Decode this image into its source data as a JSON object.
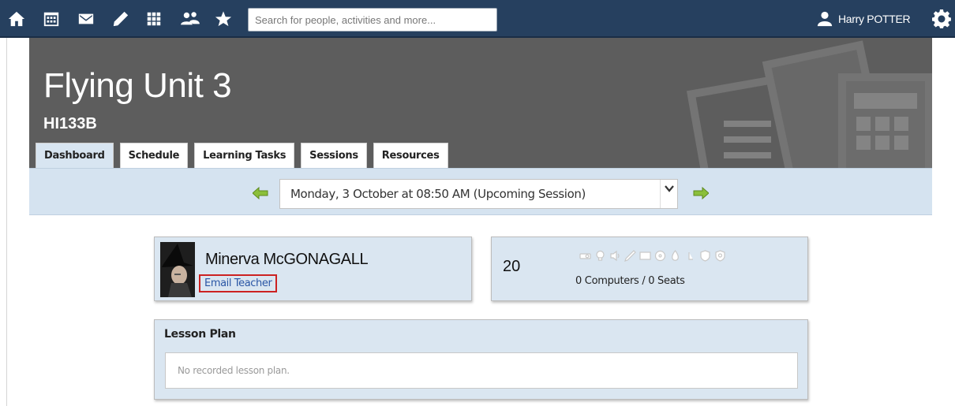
{
  "topbar": {
    "icons": [
      "home-icon",
      "calendar-icon",
      "mail-icon",
      "pencil-icon",
      "apps-grid-icon",
      "people-icon",
      "star-icon"
    ],
    "search_placeholder": "Search for people, activities and more...",
    "user_name": "Harry POTTER",
    "colors": {
      "bar": "#26405f"
    }
  },
  "course": {
    "title": "Flying Unit 3",
    "code": "HI133B"
  },
  "tabs": [
    {
      "label": "Dashboard",
      "active": true
    },
    {
      "label": "Schedule",
      "active": false
    },
    {
      "label": "Learning Tasks",
      "active": false
    },
    {
      "label": "Sessions",
      "active": false
    },
    {
      "label": "Resources",
      "active": false
    }
  ],
  "session": {
    "selected": "Monday, 3 October at 08:50 AM (Upcoming Session)",
    "arrow_color": "#8bbf3a"
  },
  "teacher": {
    "name": "Minerva McGONAGALL",
    "email_label": "Email Teacher"
  },
  "room": {
    "number": "20",
    "summary": "0 Computers / 0 Seats",
    "facility_icons": [
      "projector-icon",
      "lightbulb-icon",
      "speaker-icon",
      "pen-icon",
      "whiteboard-icon",
      "disc-icon",
      "drop-icon",
      "lamp-icon",
      "shield-icon",
      "badge-icon"
    ]
  },
  "lesson_plan": {
    "title": "Lesson Plan",
    "empty_text": "No recorded lesson plan."
  }
}
